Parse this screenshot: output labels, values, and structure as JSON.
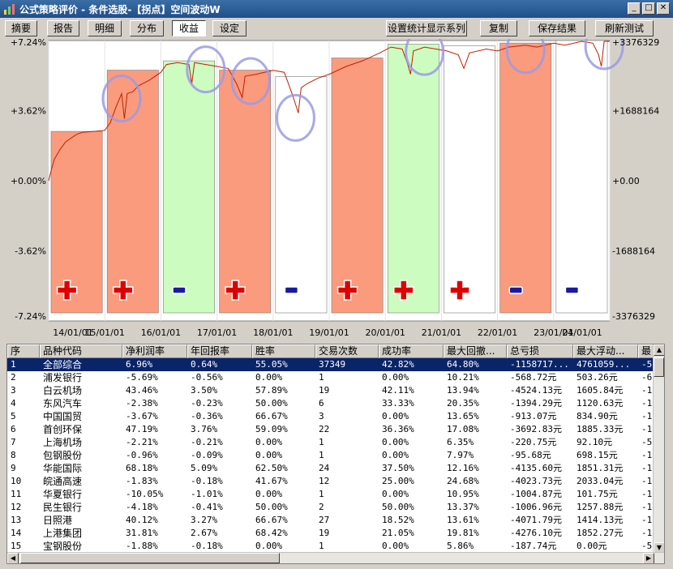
{
  "window": {
    "title": "公式策略评价 - 条件选股-【拐点】空间波动W"
  },
  "tabs": [
    {
      "label": "摘要"
    },
    {
      "label": "报告"
    },
    {
      "label": "明细"
    },
    {
      "label": "分布"
    },
    {
      "label": "收益"
    },
    {
      "label": "设定"
    }
  ],
  "active_tab": "收益",
  "toolbar": {
    "series_settings": "设置统计显示系列",
    "copy": "复制",
    "save": "保存结果",
    "refresh": "刷新测试"
  },
  "chart_data": {
    "type": "bar",
    "categories": [
      "14/01/01",
      "15/01/01",
      "16/01/01",
      "17/01/01",
      "18/01/01",
      "19/01/01",
      "20/01/01",
      "21/01/01",
      "22/01/01",
      "23/01/01",
      "24/01/01"
    ],
    "left_axis_labels": [
      "+7.24%",
      "+3.62%",
      "+0.00%",
      "-3.62%",
      "-7.24%"
    ],
    "right_axis_labels": [
      "+3376329",
      "+1688164",
      "+0.00",
      "-1688164",
      "-3376329"
    ],
    "ylim": [
      -7.24,
      7.24
    ],
    "yearly_bars": [
      {
        "value": 2.55,
        "color": "salmon",
        "sign": "+"
      },
      {
        "value": 5.71,
        "color": "salmon",
        "sign": "+"
      },
      {
        "value": 6.19,
        "color": "lightgreen",
        "sign": "-"
      },
      {
        "value": 5.71,
        "color": "salmon",
        "sign": "+"
      },
      {
        "value": 5.38,
        "color": "white",
        "sign": "-"
      },
      {
        "value": 6.34,
        "color": "salmon",
        "sign": "+"
      },
      {
        "value": 7.05,
        "color": "lightgreen",
        "sign": "+"
      },
      {
        "value": 6.96,
        "color": "white",
        "sign": "+"
      },
      {
        "value": 7.11,
        "color": "salmon",
        "sign": "-"
      },
      {
        "value": 7.24,
        "color": "white",
        "sign": "-"
      }
    ],
    "cumulative_line": [
      [
        0,
        0.0
      ],
      [
        0.05,
        0.6
      ],
      [
        0.1,
        1.1
      ],
      [
        0.2,
        1.6
      ],
      [
        0.3,
        2.0
      ],
      [
        0.4,
        2.2
      ],
      [
        0.5,
        2.4
      ],
      [
        0.6,
        2.5
      ],
      [
        0.8,
        2.55
      ],
      [
        1.0,
        2.6
      ],
      [
        1.1,
        3.0
      ],
      [
        1.2,
        3.8
      ],
      [
        1.3,
        4.5
      ],
      [
        1.35,
        3.2
      ],
      [
        1.4,
        4.5
      ],
      [
        1.5,
        4.6
      ],
      [
        1.6,
        4.9
      ],
      [
        1.8,
        5.2
      ],
      [
        2.0,
        5.6
      ],
      [
        2.1,
        6.0
      ],
      [
        2.3,
        6.1
      ],
      [
        2.5,
        6.0
      ],
      [
        2.55,
        5.0
      ],
      [
        2.6,
        6.1
      ],
      [
        2.8,
        6.0
      ],
      [
        3.0,
        5.9
      ],
      [
        3.2,
        5.8
      ],
      [
        3.35,
        5.0
      ],
      [
        3.45,
        4.3
      ],
      [
        3.5,
        5.4
      ],
      [
        3.7,
        5.5
      ],
      [
        4.0,
        5.7
      ],
      [
        4.2,
        5.6
      ],
      [
        4.35,
        4.4
      ],
      [
        4.45,
        3.5
      ],
      [
        4.5,
        4.8
      ],
      [
        4.6,
        5.0
      ],
      [
        4.8,
        5.3
      ],
      [
        5.0,
        5.5
      ],
      [
        5.3,
        5.9
      ],
      [
        5.6,
        6.2
      ],
      [
        5.9,
        6.6
      ],
      [
        6.1,
        6.9
      ],
      [
        6.3,
        6.8
      ],
      [
        6.4,
        6.0
      ],
      [
        6.45,
        5.5
      ],
      [
        6.5,
        6.7
      ],
      [
        6.7,
        6.9
      ],
      [
        6.9,
        6.8
      ],
      [
        7.1,
        6.7
      ],
      [
        7.3,
        6.5
      ],
      [
        7.4,
        5.8
      ],
      [
        7.5,
        6.6
      ],
      [
        7.8,
        6.8
      ],
      [
        8.0,
        6.7
      ],
      [
        8.2,
        6.9
      ],
      [
        8.5,
        7.0
      ],
      [
        8.7,
        6.9
      ],
      [
        9.0,
        7.1
      ],
      [
        9.2,
        7.0
      ],
      [
        9.5,
        7.2
      ],
      [
        9.7,
        7.1
      ],
      [
        9.8,
        6.5
      ],
      [
        9.85,
        5.9
      ],
      [
        9.9,
        7.2
      ],
      [
        10.0,
        7.2
      ]
    ],
    "highlight_circles": [
      1.3,
      2.8,
      3.6,
      4.4,
      6.7,
      8.5,
      9.9
    ]
  },
  "table": {
    "columns": [
      "序",
      "品种代码",
      "净利润率",
      "年回报率",
      "胜率",
      "交易次数",
      "成功率",
      "最大回撤...",
      "总亏损",
      "最大浮动...",
      "最"
    ],
    "rows": [
      [
        "1",
        "全部综合",
        "6.96%",
        "0.64%",
        "55.05%",
        "37349",
        "42.82%",
        "64.80%",
        "-1158717...",
        "4761059...",
        "-5"
      ],
      [
        "2",
        "浦发银行",
        "-5.69%",
        "-0.56%",
        "0.00%",
        "1",
        "0.00%",
        "10.21%",
        "-568.72元",
        "503.26元",
        "-6"
      ],
      [
        "3",
        "白云机场",
        "43.46%",
        "3.50%",
        "57.89%",
        "19",
        "42.11%",
        "13.94%",
        "-4524.13元",
        "1605.84元",
        "-1"
      ],
      [
        "4",
        "东风汽车",
        "-2.38%",
        "-0.23%",
        "50.00%",
        "6",
        "33.33%",
        "20.35%",
        "-1394.29元",
        "1120.63元",
        "-1"
      ],
      [
        "5",
        "中国国贸",
        "-3.67%",
        "-0.36%",
        "66.67%",
        "3",
        "0.00%",
        "13.65%",
        "-913.07元",
        "834.90元",
        "-1"
      ],
      [
        "6",
        "首创环保",
        "47.19%",
        "3.76%",
        "59.09%",
        "22",
        "36.36%",
        "17.08%",
        "-3692.83元",
        "1885.33元",
        "-1"
      ],
      [
        "7",
        "上海机场",
        "-2.21%",
        "-0.21%",
        "0.00%",
        "1",
        "0.00%",
        "6.35%",
        "-220.75元",
        "92.10元",
        "-5"
      ],
      [
        "8",
        "包钢股份",
        "-0.96%",
        "-0.09%",
        "0.00%",
        "1",
        "0.00%",
        "7.97%",
        "-95.68元",
        "698.15元",
        "-1"
      ],
      [
        "9",
        "华能国际",
        "68.18%",
        "5.09%",
        "62.50%",
        "24",
        "37.50%",
        "12.16%",
        "-4135.60元",
        "1851.31元",
        "-1"
      ],
      [
        "10",
        "皖通高速",
        "-1.83%",
        "-0.18%",
        "41.67%",
        "12",
        "25.00%",
        "24.68%",
        "-4023.73元",
        "2033.04元",
        "-1"
      ],
      [
        "11",
        "华夏银行",
        "-10.05%",
        "-1.01%",
        "0.00%",
        "1",
        "0.00%",
        "10.95%",
        "-1004.87元",
        "101.75元",
        "-1"
      ],
      [
        "12",
        "民生银行",
        "-4.18%",
        "-0.41%",
        "50.00%",
        "2",
        "50.00%",
        "13.37%",
        "-1006.96元",
        "1257.88元",
        "-1"
      ],
      [
        "13",
        "日照港",
        "40.12%",
        "3.27%",
        "66.67%",
        "27",
        "18.52%",
        "13.61%",
        "-4071.79元",
        "1414.13元",
        "-1"
      ],
      [
        "14",
        "上港集团",
        "31.81%",
        "2.67%",
        "68.42%",
        "19",
        "21.05%",
        "19.81%",
        "-4276.10元",
        "1852.27元",
        "-1"
      ],
      [
        "15",
        "宝钢股份",
        "-1.88%",
        "-0.18%",
        "0.00%",
        "1",
        "0.00%",
        "5.86%",
        "-187.74元",
        "0.00元",
        "-5"
      ]
    ]
  }
}
